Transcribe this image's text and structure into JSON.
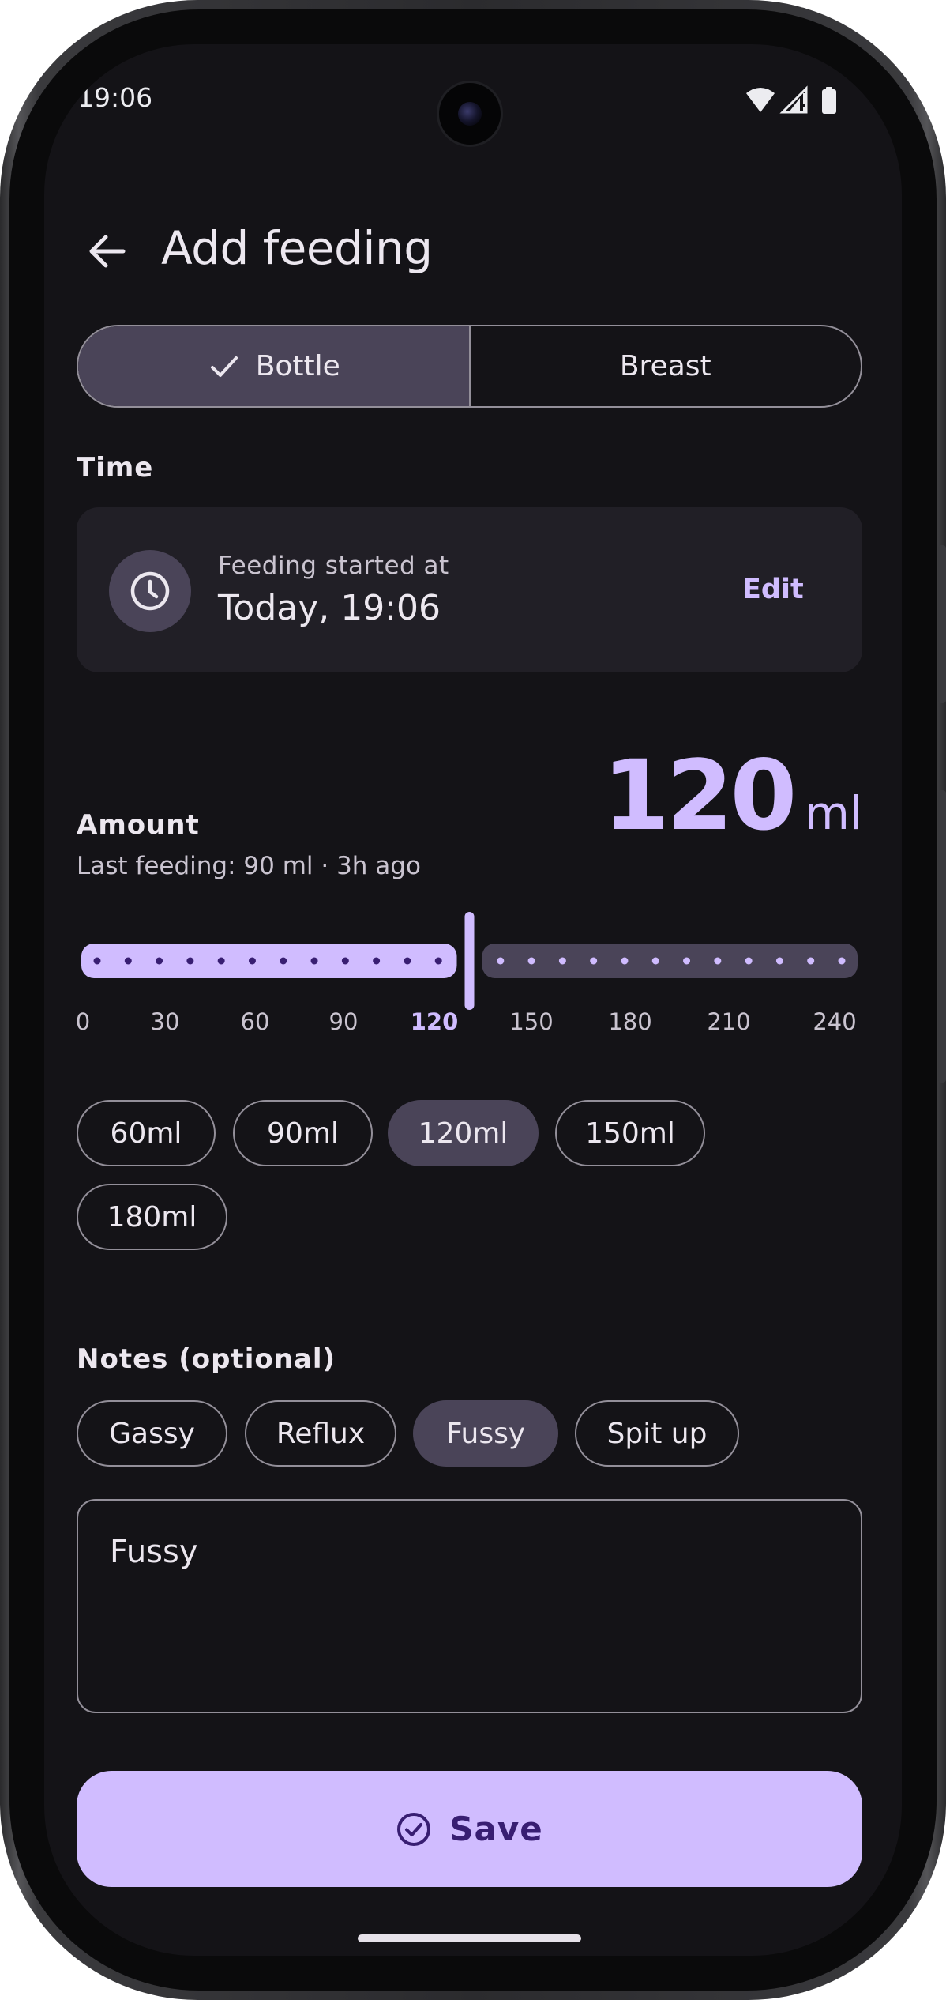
{
  "status_bar": {
    "time": "19:06",
    "icons": [
      "wifi-icon",
      "signal-icon",
      "battery-icon"
    ]
  },
  "header": {
    "title": "Add feeding",
    "back_icon": "arrow-back-icon"
  },
  "feeding_type": {
    "options": [
      {
        "label": "Bottle",
        "selected": true
      },
      {
        "label": "Breast",
        "selected": false
      }
    ]
  },
  "time_section": {
    "label": "Time",
    "card_subtitle": "Feeding started at",
    "card_value": "Today, 19:06",
    "edit_label": "Edit",
    "icon": "clock-icon"
  },
  "amount_section": {
    "label": "Amount",
    "last_feeding": "Last feeding: 90 ml · 3h ago",
    "value": "120",
    "unit": "ml",
    "slider": {
      "min": 0,
      "max": 240,
      "value": 120,
      "step": 10
    },
    "ticks": [
      "0",
      "30",
      "60",
      "90",
      "120",
      "150",
      "180",
      "210",
      "240"
    ],
    "active_tick": "120",
    "presets": [
      {
        "label": "60ml",
        "selected": false
      },
      {
        "label": "90ml",
        "selected": false
      },
      {
        "label": "120ml",
        "selected": true
      },
      {
        "label": "150ml",
        "selected": false
      },
      {
        "label": "180ml",
        "selected": false
      }
    ]
  },
  "notes_section": {
    "label": "Notes (optional)",
    "tags": [
      {
        "label": "Gassy",
        "selected": false
      },
      {
        "label": "Reflux",
        "selected": false
      },
      {
        "label": "Fussy",
        "selected": true
      },
      {
        "label": "Spit up",
        "selected": false
      }
    ],
    "text": "Fussy"
  },
  "save_button": {
    "label": "Save",
    "icon": "check-circle-icon"
  },
  "colors": {
    "background": "#141317",
    "accent": "#d0bcff",
    "selected_container": "#4a4458",
    "surface_card": "#211f26",
    "outline": "#938f99",
    "on_accent": "#381e72"
  }
}
